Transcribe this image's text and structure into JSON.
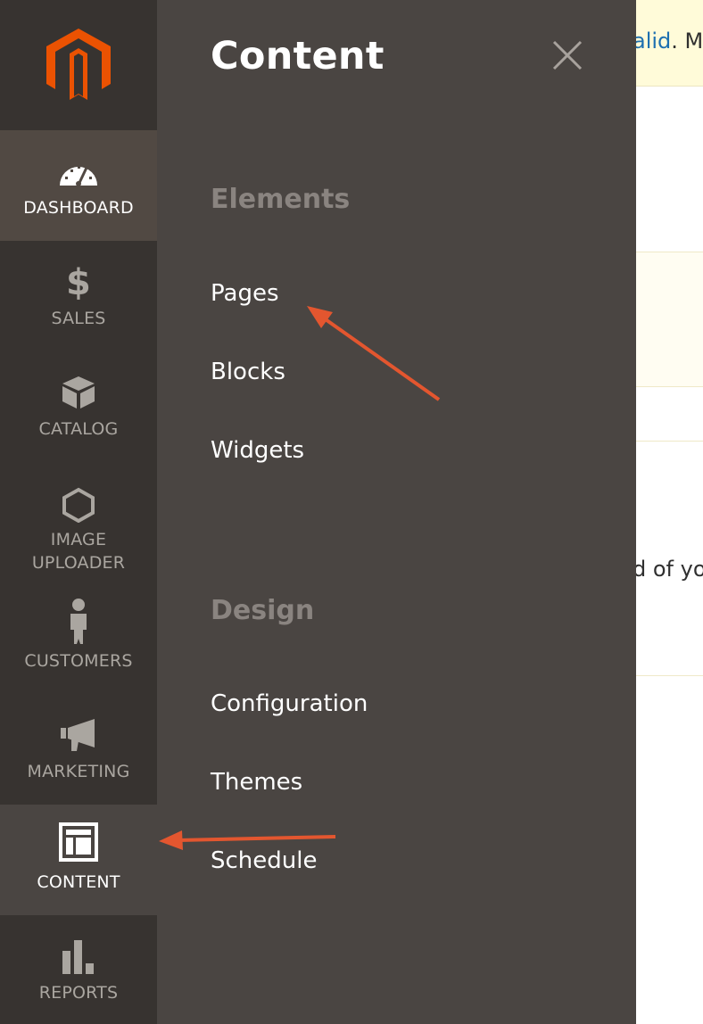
{
  "sidebar": {
    "items": [
      {
        "label": "DASHBOARD",
        "icon": "dashboard-gauge-icon"
      },
      {
        "label": "SALES",
        "icon": "dollar-icon"
      },
      {
        "label": "CATALOG",
        "icon": "box-icon"
      },
      {
        "label_line1": "IMAGE",
        "label_line2": "UPLOADER",
        "icon": "hexagon-icon"
      },
      {
        "label": "CUSTOMERS",
        "icon": "person-icon"
      },
      {
        "label": "MARKETING",
        "icon": "megaphone-icon"
      },
      {
        "label": "CONTENT",
        "icon": "layout-icon"
      },
      {
        "label": "REPORTS",
        "icon": "bar-chart-icon"
      }
    ]
  },
  "flyout": {
    "title": "Content",
    "sections": [
      {
        "title": "Elements",
        "links": [
          "Pages",
          "Blocks",
          "Widgets"
        ]
      },
      {
        "title": "Design",
        "links": [
          "Configuration",
          "Themes",
          "Schedule"
        ]
      }
    ]
  },
  "background": {
    "notice_link_fragment": "alid",
    "notice_text_fragment": ". M",
    "body_fragment": "d of yo"
  },
  "colors": {
    "brand_orange": "#eb5202",
    "sidebar_bg": "#373330",
    "flyout_bg": "#4a4542",
    "annotation_arrow": "#e3562f"
  }
}
